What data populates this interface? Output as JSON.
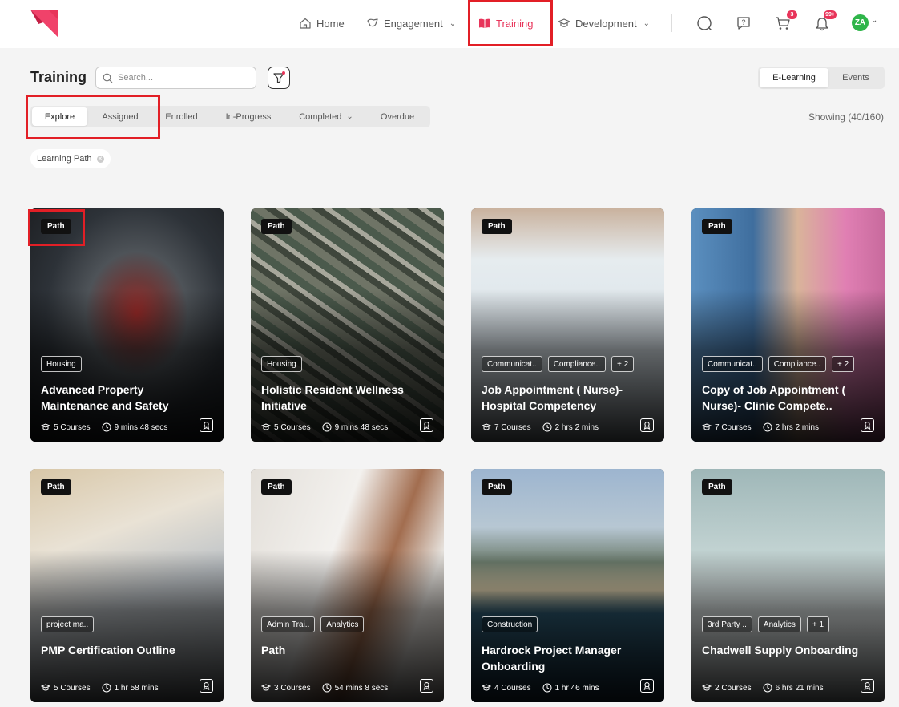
{
  "nav": {
    "home": "Home",
    "engagement": "Engagement",
    "training": "Training",
    "development": "Development",
    "cart_badge": "3",
    "notifications_badge": "99+",
    "avatar_initials": "ZA",
    "accent_color": "#e8345a",
    "avatar_color": "#2fb54a"
  },
  "header": {
    "title": "Training",
    "search_placeholder": "Search...",
    "mode_tabs": [
      "E-Learning",
      "Events"
    ],
    "active_mode": "E-Learning"
  },
  "tabs": {
    "items": [
      "Explore",
      "Assigned",
      "Enrolled",
      "In-Progress",
      "Completed",
      "Overdue"
    ],
    "active": "Explore"
  },
  "showing": "Showing (40/160)",
  "filter_chip": "Learning Path",
  "cards": [
    {
      "badge": "Path",
      "tags": [
        "Housing"
      ],
      "title": "Advanced Property Maintenance and Safety",
      "courses": "5 Courses",
      "duration": "9 mins 48 secs"
    },
    {
      "badge": "Path",
      "tags": [
        "Housing"
      ],
      "title": "Holistic Resident Wellness Initiative",
      "courses": "5 Courses",
      "duration": "9 mins 48 secs"
    },
    {
      "badge": "Path",
      "tags": [
        "Communicat..",
        "Compliance..",
        "+ 2"
      ],
      "title": "Job Appointment ( Nurse)- Hospital Competency",
      "courses": "7 Courses",
      "duration": "2 hrs 2 mins"
    },
    {
      "badge": "Path",
      "tags": [
        "Communicat..",
        "Compliance..",
        "+ 2"
      ],
      "title": "Copy of Job Appointment ( Nurse)- Clinic Compete..",
      "courses": "7 Courses",
      "duration": "2 hrs 2 mins"
    },
    {
      "badge": "Path",
      "tags": [
        "project ma.."
      ],
      "title": "PMP Certification Outline",
      "courses": "5 Courses",
      "duration": "1 hr 58 mins"
    },
    {
      "badge": "Path",
      "tags": [
        "Admin Trai..",
        "Analytics"
      ],
      "title": "Path",
      "courses": "3 Courses",
      "duration": "54 mins 8 secs"
    },
    {
      "badge": "Path",
      "tags": [
        "Construction"
      ],
      "title": "Hardrock Project Manager Onboarding",
      "courses": "4 Courses",
      "duration": "1 hr 46 mins"
    },
    {
      "badge": "Path",
      "tags": [
        "3rd Party ..",
        "Analytics",
        "+ 1"
      ],
      "title": "Chadwell Supply Onboarding",
      "courses": "2 Courses",
      "duration": "6 hrs 21 mins"
    }
  ]
}
